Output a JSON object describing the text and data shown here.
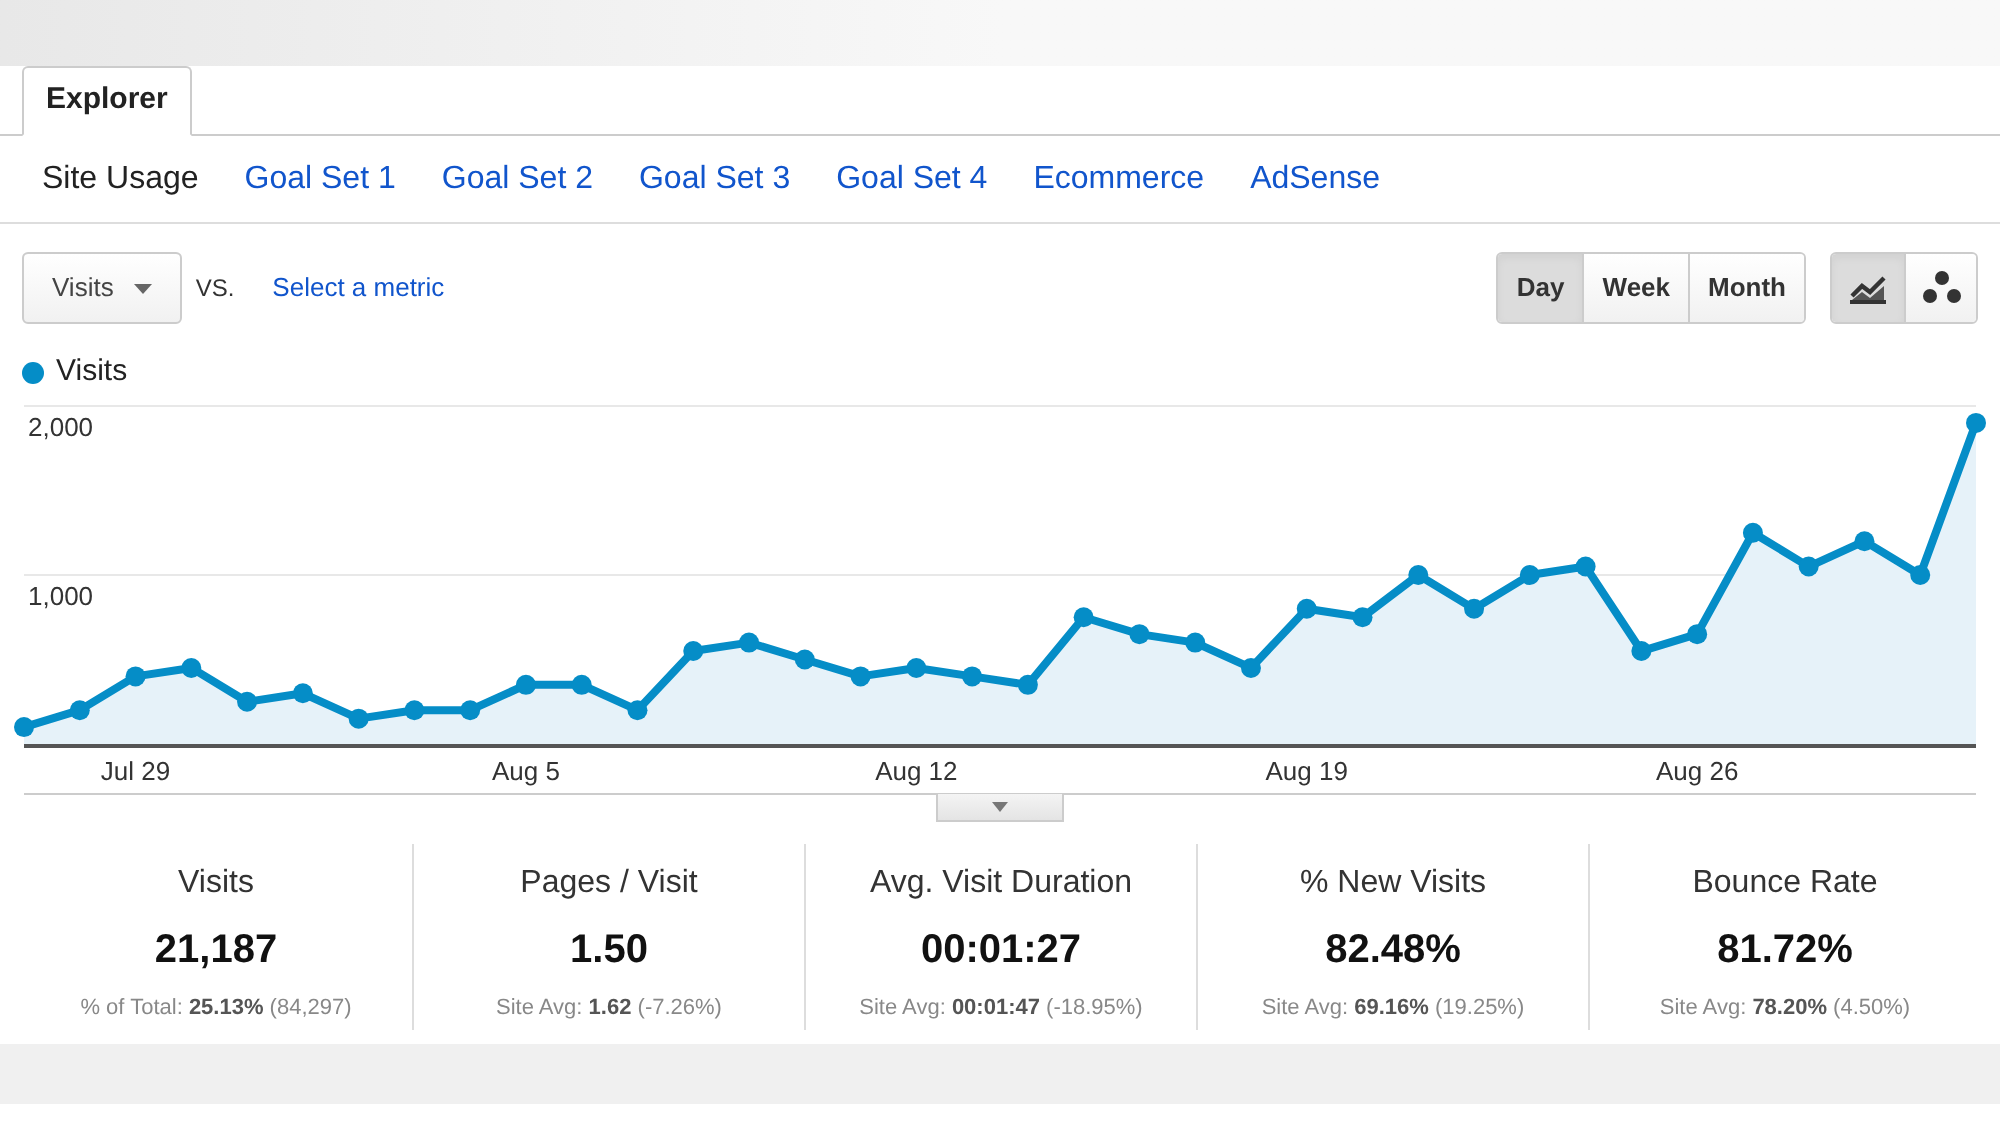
{
  "tabs": [
    {
      "label": "Explorer",
      "selected": true
    }
  ],
  "subnav": [
    {
      "label": "Site Usage",
      "selected": true
    },
    {
      "label": "Goal Set 1",
      "selected": false
    },
    {
      "label": "Goal Set 2",
      "selected": false
    },
    {
      "label": "Goal Set 3",
      "selected": false
    },
    {
      "label": "Goal Set 4",
      "selected": false
    },
    {
      "label": "Ecommerce",
      "selected": false
    },
    {
      "label": "AdSense",
      "selected": false
    }
  ],
  "metric_select": {
    "value": "Visits"
  },
  "vs_label": "VS.",
  "compare_link": "Select a metric",
  "periods": [
    {
      "label": "Day",
      "selected": true
    },
    {
      "label": "Week",
      "selected": false
    },
    {
      "label": "Month",
      "selected": false
    }
  ],
  "chart_types": [
    {
      "kind": "line",
      "selected": true
    },
    {
      "kind": "motion",
      "selected": false
    }
  ],
  "chart_data": {
    "type": "area",
    "categories": [
      null,
      null,
      "Jul 29",
      null,
      null,
      null,
      null,
      null,
      null,
      "Aug 5",
      null,
      null,
      null,
      null,
      null,
      null,
      "Aug 12",
      null,
      null,
      null,
      null,
      null,
      null,
      "Aug 19",
      null,
      null,
      null,
      null,
      null,
      null,
      "Aug 26",
      null,
      null,
      null,
      null,
      null
    ],
    "series": [
      {
        "name": "Visits",
        "color": "#058dc7",
        "values": [
          100,
          200,
          400,
          450,
          250,
          300,
          150,
          200,
          200,
          350,
          350,
          200,
          550,
          600,
          500,
          400,
          450,
          400,
          350,
          750,
          650,
          600,
          450,
          800,
          750,
          1000,
          800,
          1000,
          1050,
          550,
          650,
          1250,
          1050,
          1200,
          1000,
          1900
        ]
      }
    ],
    "ylim": [
      0,
      2000
    ],
    "yticks": [
      {
        "value": 1000,
        "label": "1,000"
      },
      {
        "value": 2000,
        "label": "2,000"
      }
    ]
  },
  "metrics": [
    {
      "title": "Visits",
      "value": "21,187",
      "detail": "% of Total: **25.13%** (84,297)"
    },
    {
      "title": "Pages / Visit",
      "value": "1.50",
      "detail": "Site Avg: **1.62** (-7.26%)"
    },
    {
      "title": "Avg. Visit Duration",
      "value": "00:01:27",
      "detail": "Site Avg: **00:01:47** (-18.95%)"
    },
    {
      "title": "% New Visits",
      "value": "82.48%",
      "detail": "Site Avg: **69.16%** (19.25%)"
    },
    {
      "title": "Bounce Rate",
      "value": "81.72%",
      "detail": "Site Avg: **78.20%** (4.50%)"
    }
  ]
}
